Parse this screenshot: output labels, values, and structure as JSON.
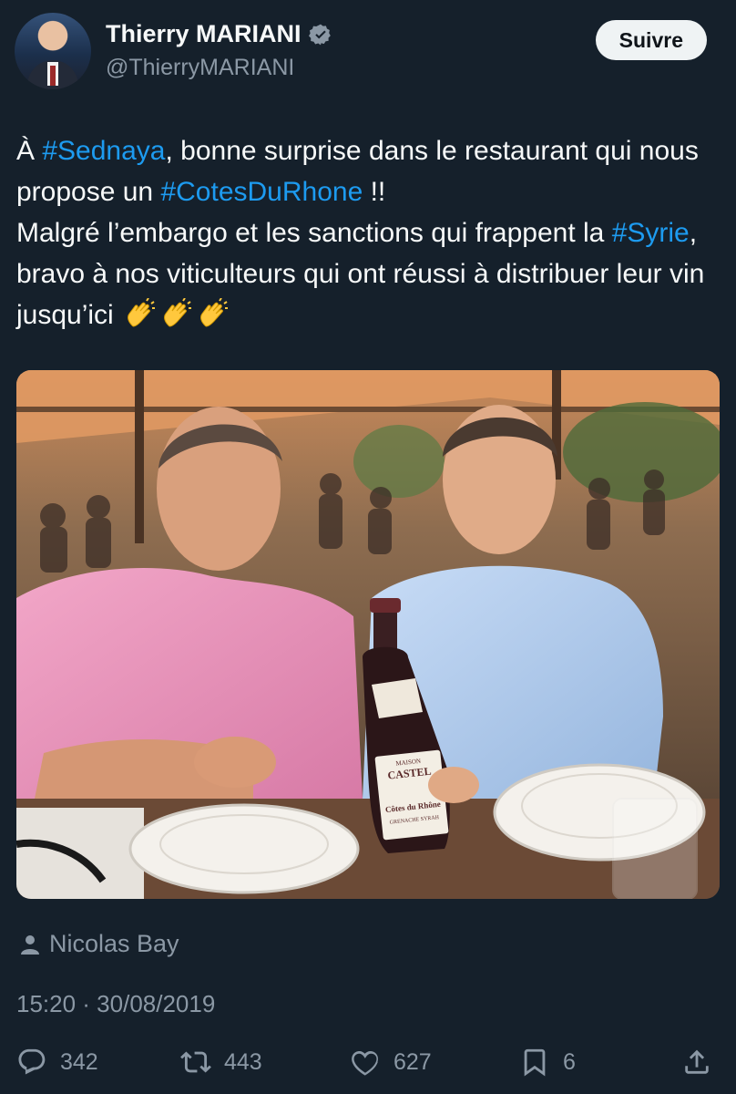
{
  "author": {
    "display_name": "Thierry MARIANI",
    "handle": "@ThierryMARIANI",
    "verified": true
  },
  "follow_button": "Suivre",
  "tweet": {
    "segments": [
      {
        "text": "À ",
        "hashtag": false
      },
      {
        "text": "#Sednaya",
        "hashtag": true
      },
      {
        "text": ", bonne surprise dans le restaurant qui nous propose un ",
        "hashtag": false
      },
      {
        "text": "#CotesDuRhone",
        "hashtag": true
      },
      {
        "text": " !!",
        "hashtag": false
      },
      {
        "text": "\nMalgré l’embargo et les sanctions  qui frappent la ",
        "hashtag": false
      },
      {
        "text": "#Syrie",
        "hashtag": true
      },
      {
        "text": ", bravo à nos viticulteurs qui ont réussi à distribuer leur vin jusqu’ici",
        "hashtag": false
      }
    ],
    "emojis": [
      "clapping-hands",
      "clapping-hands",
      "clapping-hands"
    ]
  },
  "photo": {
    "bottle_label": {
      "brand_small": "MAISON",
      "brand": "CASTEL",
      "appellation": "Côtes du Rhône",
      "variety": "GRENACHE SYRAH"
    }
  },
  "tagged_user": "Nicolas Bay",
  "timestamp": "15:20 · 30/08/2019",
  "metrics": {
    "replies": "342",
    "retweets": "443",
    "likes": "627",
    "bookmarks": "6"
  },
  "colors": {
    "background": "#15202b",
    "text": "#f7f9f9",
    "secondary": "#8b98a5",
    "accent": "#1d9bf0"
  }
}
